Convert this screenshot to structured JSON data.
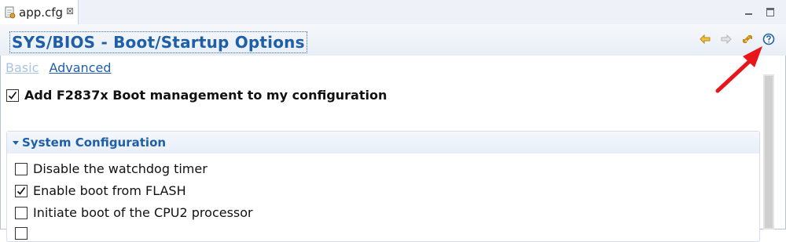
{
  "tab": {
    "label": "app.cfg",
    "close": "⊠"
  },
  "page": {
    "title": "SYS/BIOS - Boot/Startup Options"
  },
  "links": {
    "basic": "Basic",
    "advanced": "Advanced"
  },
  "boot_mgmt": {
    "label": "Add F2837x Boot management to my configuration",
    "checked": true
  },
  "section": {
    "title": "System Configuration",
    "options": [
      {
        "label": "Disable the watchdog timer",
        "checked": false
      },
      {
        "label": "Enable boot from FLASH",
        "checked": true
      },
      {
        "label": "Initiate boot of the CPU2 processor",
        "checked": false
      }
    ]
  },
  "icons": {
    "nav_back": "arrow-left-icon",
    "nav_forward": "arrow-right-icon",
    "sync": "sync-icon",
    "help": "help-icon",
    "annotation": "red-arrow-annotation"
  },
  "colors": {
    "accent": "#1e5fa8",
    "link_disabled": "#a9c4e0",
    "annotation": "#e8151b"
  }
}
